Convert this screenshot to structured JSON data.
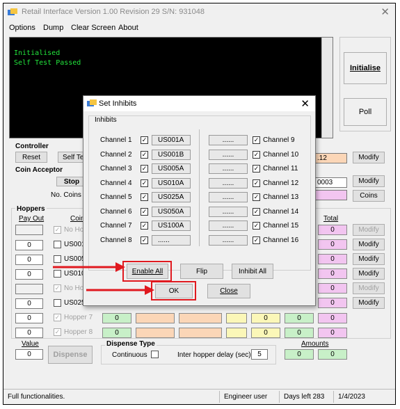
{
  "window": {
    "title": "Retail Interface   Version 1.00 Revision 29   S/N: 931048",
    "close_glyph": "✕"
  },
  "menu": [
    "Options",
    "Dump",
    "Clear Screen",
    "About"
  ],
  "console": {
    "lines": [
      "Initialised",
      "Self Test Passed"
    ],
    "text_color": "#22e53c"
  },
  "side_buttons": {
    "initialise": "Initialise",
    "poll": "Poll"
  },
  "controller": {
    "title": "Controller",
    "reset": "Reset",
    "self_test": "Self Te",
    "value": ".12",
    "modify": "Modify"
  },
  "coin_acceptor": {
    "title": "Coin Acceptor",
    "stop": "Stop",
    "no_coins": "No. Coins",
    "value": "0003",
    "modify": "Modify",
    "coins": "Coins"
  },
  "hoppers": {
    "title": "Hoppers",
    "pay_out": "Pay Out",
    "coin_col": "Coin",
    "total_col": "Total",
    "rows": [
      {
        "payout": "",
        "checked": true,
        "name": "No Ho",
        "dim": true,
        "total": "0",
        "modify": "Modify",
        "modify_dim": true
      },
      {
        "payout": "0",
        "checked": false,
        "name": "US001",
        "dim": false,
        "total": "0",
        "modify": "Modify",
        "modify_dim": false
      },
      {
        "payout": "0",
        "checked": false,
        "name": "US005",
        "dim": false,
        "total": "0",
        "modify": "Modify",
        "modify_dim": false
      },
      {
        "payout": "0",
        "checked": false,
        "name": "US010",
        "dim": false,
        "total": "0",
        "modify": "Modify",
        "modify_dim": false
      },
      {
        "payout": "",
        "checked": true,
        "name": "No Ho",
        "dim": true,
        "total": "0",
        "modify": "Modify",
        "modify_dim": true
      },
      {
        "payout": "0",
        "checked": false,
        "name": "US025",
        "dim": false,
        "total": "0",
        "modify": "Modify",
        "modify_dim": false
      },
      {
        "payout": "0",
        "checked": true,
        "name": "Hopper 7",
        "dim": true,
        "cols": [
          "0",
          "",
          "",
          "0",
          "0"
        ],
        "total": "0"
      },
      {
        "payout": "0",
        "checked": true,
        "name": "Hopper 8",
        "dim": true,
        "cols": [
          "0",
          "",
          "",
          "0",
          "0"
        ],
        "total": "0"
      }
    ]
  },
  "value_box": {
    "label": "Value",
    "value": "0",
    "dispense": "Dispense"
  },
  "dispense_type": {
    "title": "Dispense Type",
    "continuous": "Continuous",
    "delay_label": "Inter hopper delay (sec)",
    "delay_value": "5"
  },
  "amounts": {
    "label": "Amounts",
    "v1": "0",
    "v2": "0"
  },
  "status": {
    "message": "Full functionalities.",
    "user": "Engineer user",
    "days": "Days left 283",
    "date": "1/4/2023"
  },
  "dialog": {
    "title": "Set Inhibits",
    "group": "Inhibits",
    "left": [
      {
        "label": "Channel 1",
        "code": "US001A"
      },
      {
        "label": "Channel 2",
        "code": "US001B"
      },
      {
        "label": "Channel 3",
        "code": "US005A"
      },
      {
        "label": "Channel 4",
        "code": "US010A"
      },
      {
        "label": "Channel 5",
        "code": "US025A"
      },
      {
        "label": "Channel 6",
        "code": "US050A"
      },
      {
        "label": "Channel 7",
        "code": "US100A"
      },
      {
        "label": "Channel 8",
        "code": "......"
      }
    ],
    "right": [
      {
        "label": "Channel 9",
        "code": "......"
      },
      {
        "label": "Channel 10",
        "code": "......"
      },
      {
        "label": "Channel 11",
        "code": "......"
      },
      {
        "label": "Channel 12",
        "code": "......"
      },
      {
        "label": "Channel 13",
        "code": "......"
      },
      {
        "label": "Channel 14",
        "code": "......"
      },
      {
        "label": "Channel 15",
        "code": "......"
      },
      {
        "label": "Channel 16",
        "code": "......"
      }
    ],
    "buttons": {
      "enable_all": "Enable All",
      "flip": "Flip",
      "inhibit_all": "Inhibit All",
      "ok": "OK",
      "close": "Close"
    }
  },
  "colors": {
    "highlight": "#e0191f",
    "pale_green": "#c8f0c8",
    "pale_orange": "#fbd6b7",
    "pale_yellow": "#fbf7b8",
    "pale_pink": "#f2c5f0"
  }
}
